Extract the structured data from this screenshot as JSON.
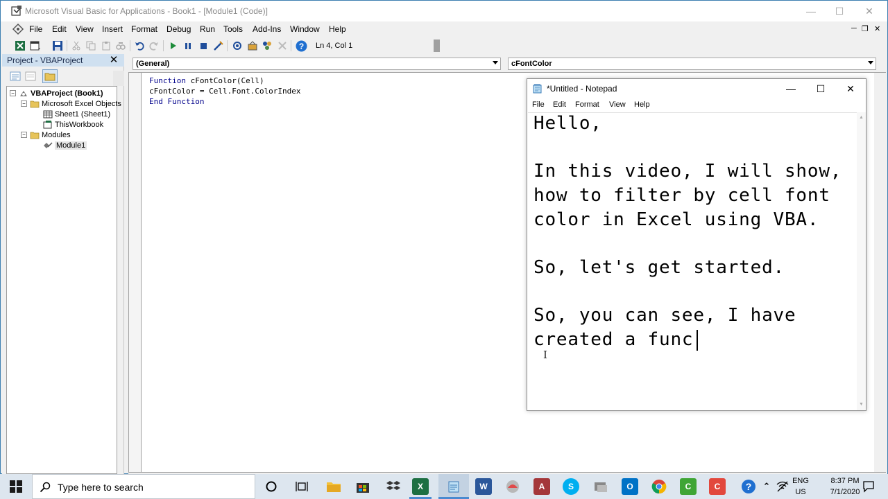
{
  "vba": {
    "title": "Microsoft Visual Basic for Applications - Book1 - [Module1 (Code)]",
    "menu": [
      "File",
      "Edit",
      "View",
      "Insert",
      "Format",
      "Debug",
      "Run",
      "Tools",
      "Add-Ins",
      "Window",
      "Help"
    ],
    "status_position": "Ln 4, Col 1",
    "project_pane_title": "Project - VBAProject",
    "tree": {
      "root": "VBAProject (Book1)",
      "excel_objects": "Microsoft Excel Objects",
      "sheet1": "Sheet1 (Sheet1)",
      "thisworkbook": "ThisWorkbook",
      "modules": "Modules",
      "module1": "Module1"
    },
    "object_combo": "(General)",
    "procedure_combo": "cFontColor",
    "code_lines": [
      {
        "kw1": "Function",
        "rest": " cFontColor(Cell)",
        "kw2": ""
      },
      {
        "kw1": "",
        "rest": "cFontColor = Cell.Font.ColorIndex",
        "kw2": ""
      },
      {
        "kw1": "End Function",
        "rest": "",
        "kw2": ""
      }
    ]
  },
  "notepad": {
    "title": "*Untitled - Notepad",
    "menu": [
      "File",
      "Edit",
      "Format",
      "View",
      "Help"
    ],
    "lines": [
      "Hello,",
      "",
      "In this video, I will show,",
      "how to filter by cell font",
      "color in Excel using VBA.",
      "",
      "So, let's get started.",
      "",
      "So, you can see, I have",
      "created a func"
    ]
  },
  "taskbar": {
    "search_placeholder": "Type here to search",
    "language": "ENG",
    "region": "US",
    "time": "8:37 PM",
    "date": "7/1/2020",
    "apps": [
      "task-view",
      "file-explorer",
      "store",
      "dropbox",
      "excel",
      "notepad",
      "word",
      "app-red-circle",
      "access",
      "skype",
      "app-gray",
      "outlook",
      "chrome",
      "camtasia-green",
      "camtasia-red"
    ]
  },
  "colors": {
    "code_keyword": "#00008b",
    "taskbar_bg": "#dde6ef",
    "excel_green": "#1d6f42",
    "word_blue": "#2b579a"
  }
}
